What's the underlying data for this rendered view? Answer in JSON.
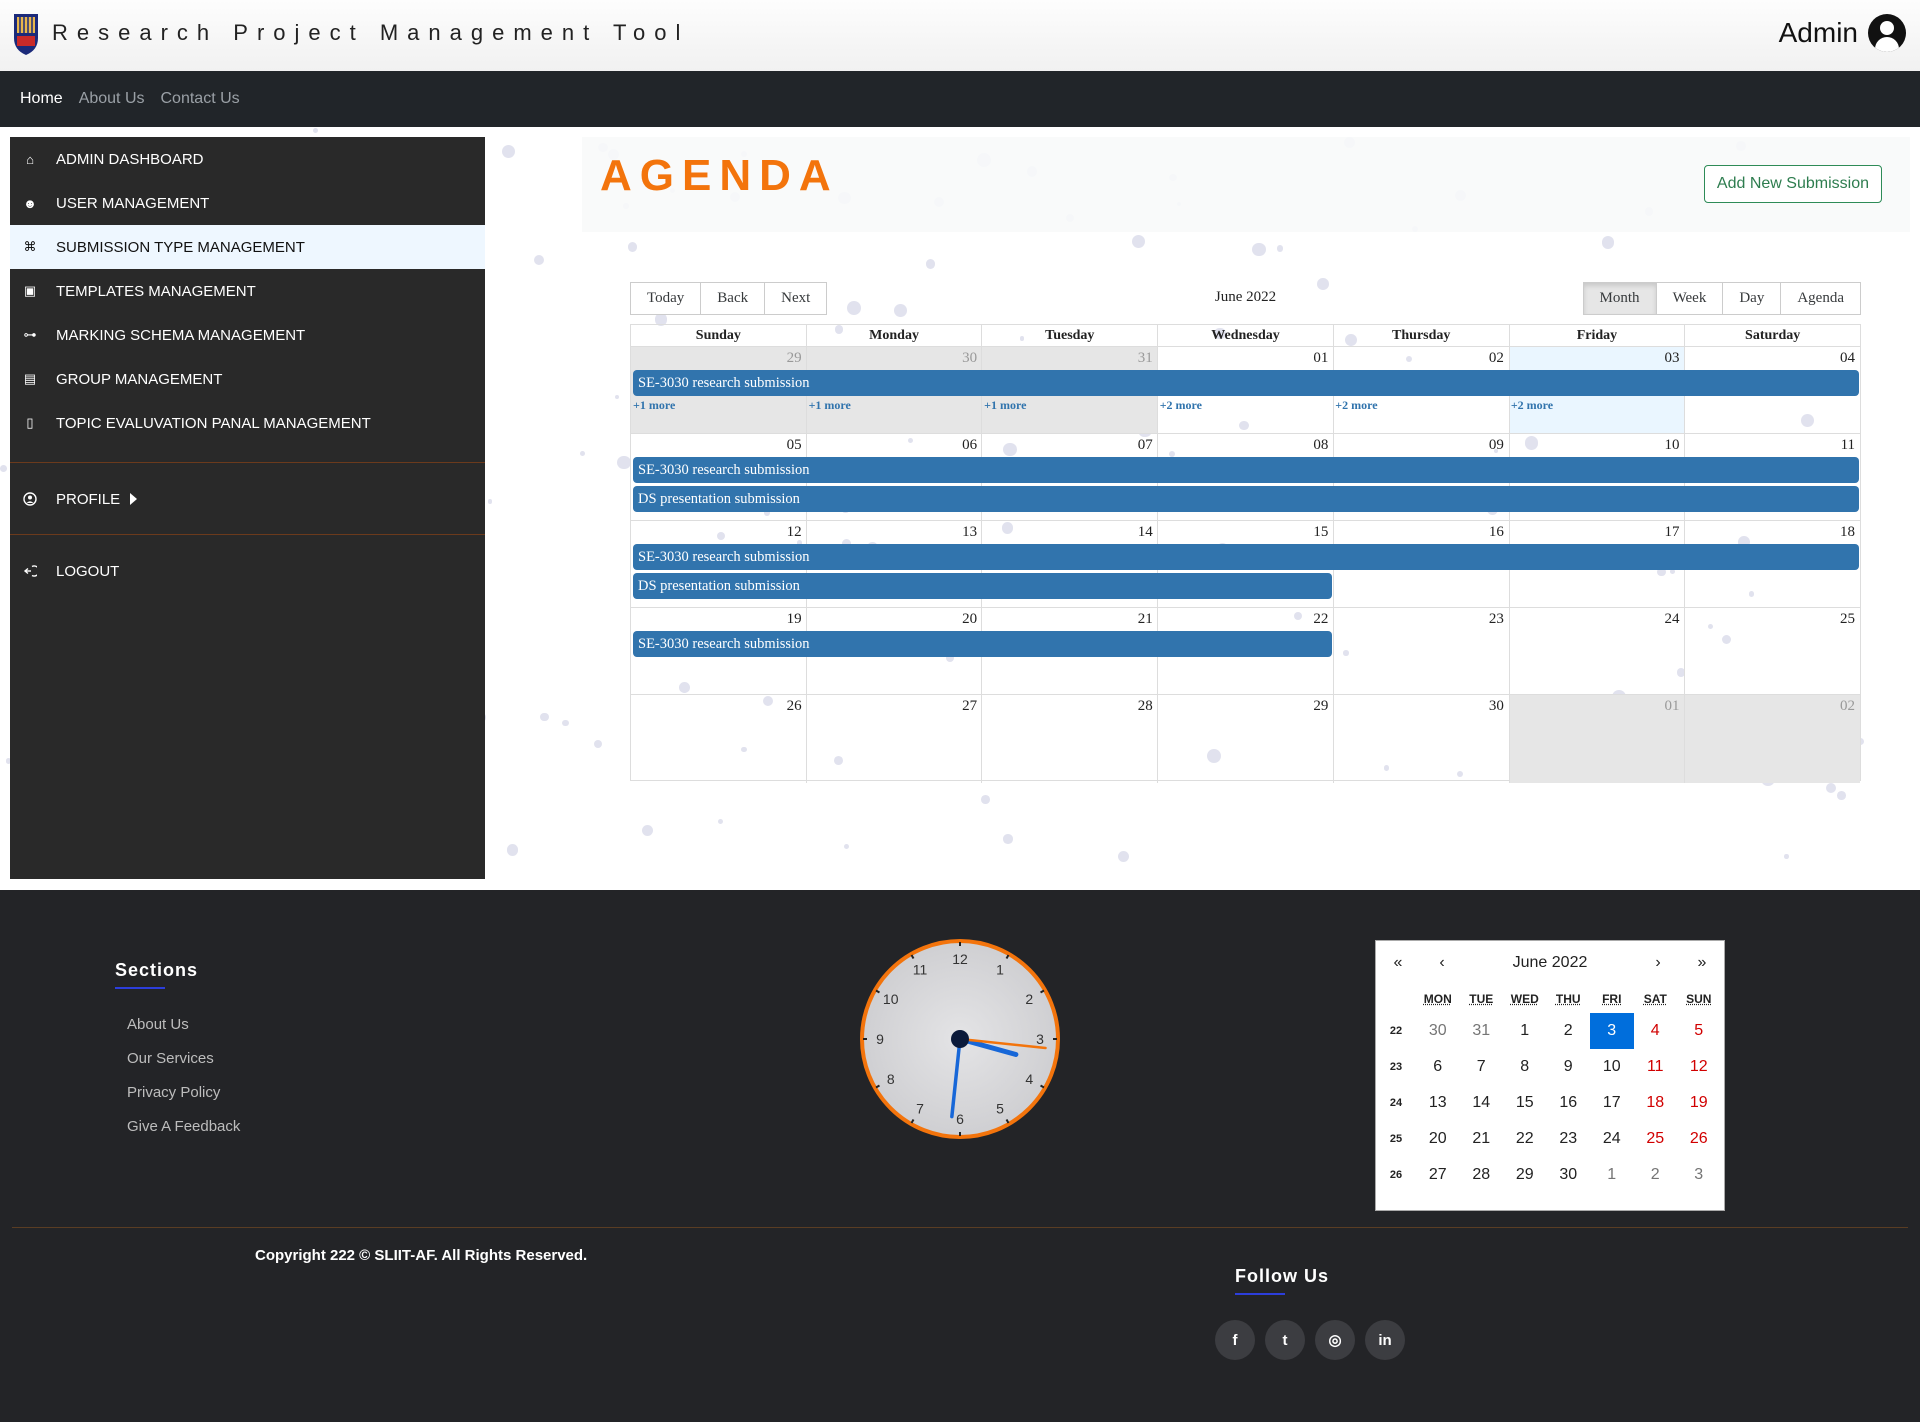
{
  "app": {
    "title": "Research Project Management Tool",
    "user": "Admin"
  },
  "nav": [
    {
      "label": "Home",
      "active": true
    },
    {
      "label": "About Us",
      "active": false
    },
    {
      "label": "Contact Us",
      "active": false
    }
  ],
  "sidebar": {
    "items": [
      {
        "label": "ADMIN DASHBOARD",
        "icon": "home-icon",
        "active": false
      },
      {
        "label": "USER MANAGEMENT",
        "icon": "user-group-icon",
        "active": false
      },
      {
        "label": "SUBMISSION TYPE MANAGEMENT",
        "icon": "submission-type-icon",
        "active": true
      },
      {
        "label": "TEMPLATES MANAGEMENT",
        "icon": "template-icon",
        "active": false
      },
      {
        "label": "MARKING SCHEMA MANAGEMENT",
        "icon": "schema-icon",
        "active": false
      },
      {
        "label": "GROUP MANAGEMENT",
        "icon": "group-icon",
        "active": false
      },
      {
        "label": "TOPIC EVALUVATION PANAL MANAGEMENT",
        "icon": "panel-icon",
        "active": false
      }
    ],
    "profile": "PROFILE",
    "logout": "LOGOUT"
  },
  "main": {
    "title": "AGENDA",
    "add_button": "Add New Submission"
  },
  "calendar": {
    "toolbar_left": [
      "Today",
      "Back",
      "Next"
    ],
    "label": "June 2022",
    "views": [
      {
        "label": "Month",
        "active": true
      },
      {
        "label": "Week",
        "active": false
      },
      {
        "label": "Day",
        "active": false
      },
      {
        "label": "Agenda",
        "active": false
      }
    ],
    "weekdays": [
      "Sunday",
      "Monday",
      "Tuesday",
      "Wednesday",
      "Thursday",
      "Friday",
      "Saturday"
    ],
    "weeks": [
      {
        "days": [
          "29",
          "30",
          "31",
          "01",
          "02",
          "03",
          "04"
        ],
        "off": [
          true,
          true,
          true,
          false,
          false,
          false,
          false
        ],
        "today": 5,
        "events": [
          {
            "title": "SE-3030 research submission",
            "start": 0,
            "span": 7
          }
        ],
        "more": [
          "+1 more",
          "+1 more",
          "+1 more",
          "+2 more",
          "+2 more",
          "+2 more",
          ""
        ]
      },
      {
        "days": [
          "05",
          "06",
          "07",
          "08",
          "09",
          "10",
          "11"
        ],
        "off": [
          false,
          false,
          false,
          false,
          false,
          false,
          false
        ],
        "today": -1,
        "events": [
          {
            "title": "SE-3030 research submission",
            "start": 0,
            "span": 7
          },
          {
            "title": "DS presentation submission",
            "start": 0,
            "span": 7
          }
        ],
        "more": []
      },
      {
        "days": [
          "12",
          "13",
          "14",
          "15",
          "16",
          "17",
          "18"
        ],
        "off": [
          false,
          false,
          false,
          false,
          false,
          false,
          false
        ],
        "today": -1,
        "events": [
          {
            "title": "SE-3030 research submission",
            "start": 0,
            "span": 7
          },
          {
            "title": "DS presentation submission",
            "start": 0,
            "span": 4
          }
        ],
        "more": []
      },
      {
        "days": [
          "19",
          "20",
          "21",
          "22",
          "23",
          "24",
          "25"
        ],
        "off": [
          false,
          false,
          false,
          false,
          false,
          false,
          false
        ],
        "today": -1,
        "events": [
          {
            "title": "SE-3030 research submission",
            "start": 0,
            "span": 4
          }
        ],
        "more": []
      },
      {
        "days": [
          "26",
          "27",
          "28",
          "29",
          "30",
          "01",
          "02"
        ],
        "off": [
          false,
          false,
          false,
          false,
          false,
          true,
          true
        ],
        "today": -1,
        "events": [],
        "more": []
      }
    ]
  },
  "footer": {
    "sections_title": "Sections",
    "links": [
      "About Us",
      "Our Services",
      "Privacy Policy",
      "Give A Feedback"
    ],
    "copyright": "Copyright 222 © SLIIT-AF. All Rights Reserved.",
    "follow_title": "Follow Us",
    "socials": [
      {
        "icon": "facebook-icon",
        "glyph": "f"
      },
      {
        "icon": "twitter-icon",
        "glyph": "t"
      },
      {
        "icon": "instagram-icon",
        "glyph": "◎"
      },
      {
        "icon": "linkedin-icon",
        "glyph": "in"
      }
    ]
  },
  "clock": {
    "numbers": [
      "12",
      "1",
      "2",
      "3",
      "4",
      "5",
      "6",
      "7",
      "8",
      "9",
      "10",
      "11"
    ],
    "hour": 3,
    "minute": 31,
    "second": 16,
    "accent": "#f3740c"
  },
  "mini_calendar": {
    "nav": [
      "«",
      "‹",
      "›",
      "»"
    ],
    "label": "June 2022",
    "headers": [
      "MON",
      "TUE",
      "WED",
      "THU",
      "FRI",
      "SAT",
      "SUN"
    ],
    "rows": [
      {
        "week": "22",
        "days": [
          "30",
          "31",
          "1",
          "2",
          "3",
          "4",
          "5"
        ],
        "out": [
          true,
          true,
          false,
          false,
          false,
          false,
          false
        ]
      },
      {
        "week": "23",
        "days": [
          "6",
          "7",
          "8",
          "9",
          "10",
          "11",
          "12"
        ],
        "out": [
          false,
          false,
          false,
          false,
          false,
          false,
          false
        ]
      },
      {
        "week": "24",
        "days": [
          "13",
          "14",
          "15",
          "16",
          "17",
          "18",
          "19"
        ],
        "out": [
          false,
          false,
          false,
          false,
          false,
          false,
          false
        ]
      },
      {
        "week": "25",
        "days": [
          "20",
          "21",
          "22",
          "23",
          "24",
          "25",
          "26"
        ],
        "out": [
          false,
          false,
          false,
          false,
          false,
          false,
          false
        ]
      },
      {
        "week": "26",
        "days": [
          "27",
          "28",
          "29",
          "30",
          "1",
          "2",
          "3"
        ],
        "out": [
          false,
          false,
          false,
          false,
          true,
          true,
          true
        ]
      }
    ],
    "selected": "3"
  },
  "colors": {
    "accent": "#f3740c",
    "event": "#3174ad",
    "selected": "#006edc",
    "weekend": "#d10000"
  }
}
